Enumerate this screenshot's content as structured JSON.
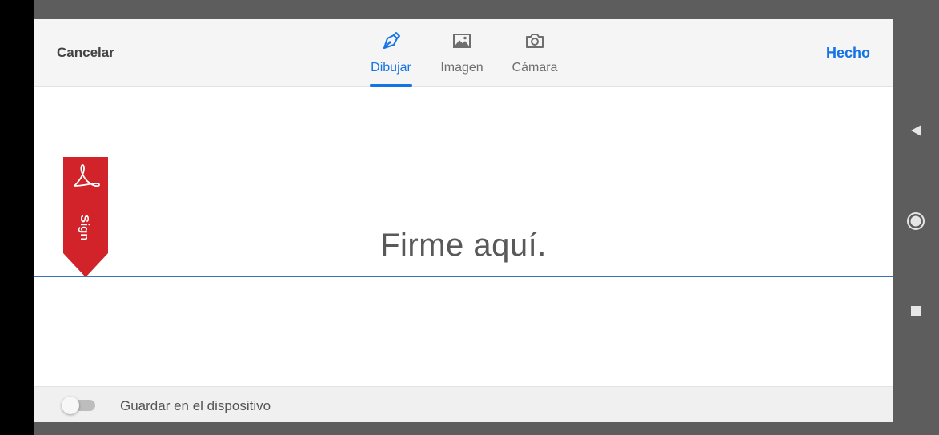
{
  "header": {
    "cancel_label": "Cancelar",
    "done_label": "Hecho",
    "tabs": [
      {
        "label": "Dibujar",
        "icon": "pen-icon",
        "active": true
      },
      {
        "label": "Imagen",
        "icon": "image-icon",
        "active": false
      },
      {
        "label": "Cámara",
        "icon": "camera-icon",
        "active": false
      }
    ]
  },
  "canvas": {
    "prompt": "Firme aquí.",
    "flag_text": "Sign",
    "flag_icon": "acrobat-logo-icon"
  },
  "footer": {
    "save_label": "Guardar en el dispositivo",
    "save_enabled": false
  },
  "system_nav": {
    "icons": [
      "back-icon",
      "home-icon",
      "recents-icon"
    ]
  },
  "colors": {
    "accent": "#1473e6",
    "flag_red": "#d2232a",
    "signature_line": "#3b74b5"
  }
}
